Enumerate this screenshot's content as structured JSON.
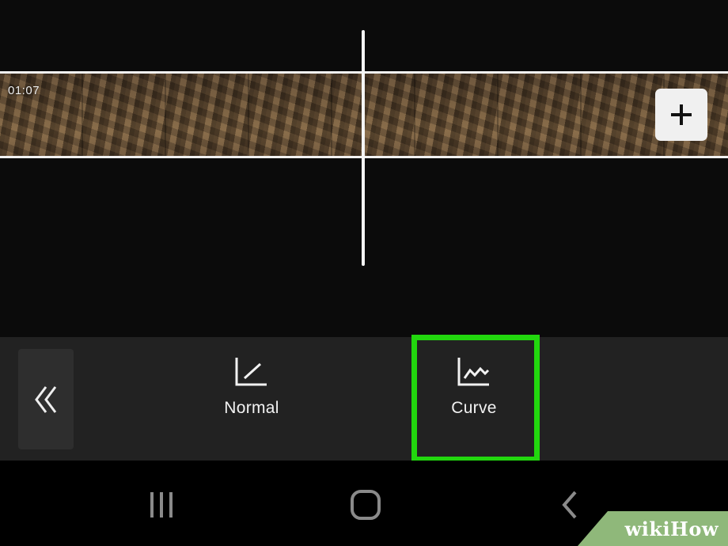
{
  "timeline": {
    "clip_duration": "01:07",
    "add_clip_icon": "plus-icon"
  },
  "toolbar": {
    "collapse_icon": "double-chevron-left-icon",
    "tools": [
      {
        "label": "Normal",
        "icon": "normal-speed-icon"
      },
      {
        "label": "Curve",
        "icon": "curve-speed-icon",
        "highlighted": true
      }
    ],
    "highlight_color": "#22d70e"
  },
  "navbar": {
    "recents_icon": "recents-icon",
    "home_icon": "home-icon",
    "back_icon": "back-icon"
  },
  "watermark": {
    "text": "wikiHow"
  }
}
